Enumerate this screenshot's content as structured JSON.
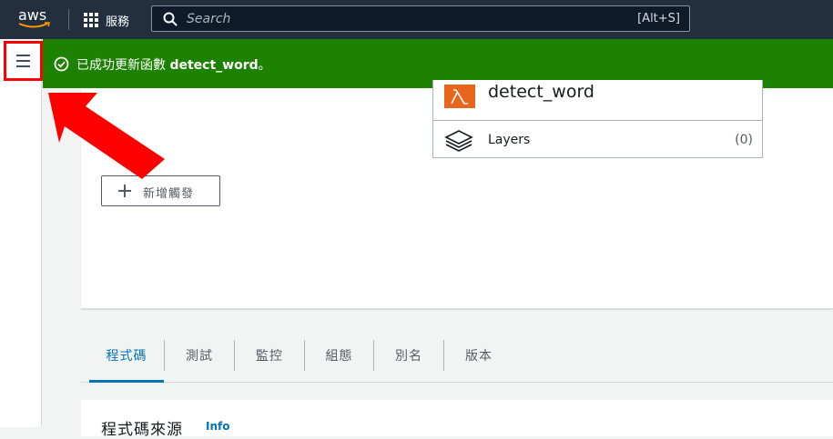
{
  "header": {
    "logo_text": "aws",
    "services_label": "服務",
    "search_placeholder": "Search",
    "search_shortcut": "[Alt+S]"
  },
  "flash": {
    "prefix": "已成功更新函數 ",
    "function_name": "detect_word",
    "suffix": "。",
    "color": "#1d8102"
  },
  "designer": {
    "function_name": "detect_word",
    "layers_label": "Layers",
    "layers_count": "(0)",
    "add_trigger_label": "新增觸發"
  },
  "tabs": [
    {
      "label": "程式碼",
      "active": true
    },
    {
      "label": "測試",
      "active": false
    },
    {
      "label": "監控",
      "active": false
    },
    {
      "label": "組態",
      "active": false
    },
    {
      "label": "別名",
      "active": false
    },
    {
      "label": "版本",
      "active": false
    }
  ],
  "code_section": {
    "title": "程式碼來源",
    "info_link": "Info"
  },
  "colors": {
    "nav_bg": "#232f3e",
    "accent": "#0073bb",
    "lambda_orange": "#e7661b",
    "annotation_red": "#ff0000"
  },
  "icons": [
    "menu-icon",
    "grid-icon",
    "search-icon",
    "check-circle-icon",
    "lambda-icon",
    "layers-icon",
    "plus-icon",
    "arrow-annotation"
  ]
}
